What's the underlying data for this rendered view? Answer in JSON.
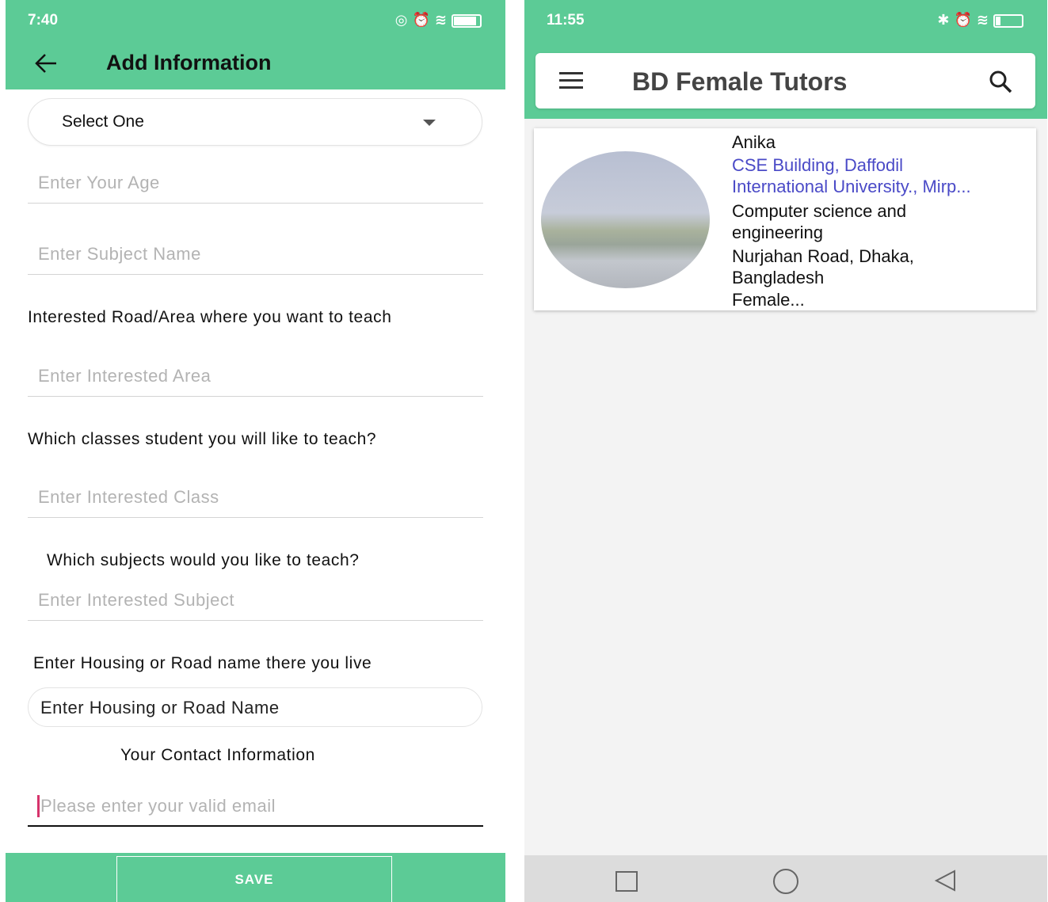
{
  "left_phone": {
    "status": {
      "time": "7:40"
    },
    "header": {
      "title": "Add Information"
    },
    "select": {
      "value": "Select One"
    },
    "fields": {
      "age_placeholder": "Enter Your Age",
      "subject_placeholder": "Enter Subject Name",
      "area_label": "Interested Road/Area where you want to teach",
      "area_placeholder": "Enter Interested Area",
      "class_label": "Which classes student you will like to teach?",
      "class_placeholder": "Enter Interested Class",
      "subjects_label": "Which subjects would you like to teach?",
      "subjects_placeholder": "Enter Interested Subject",
      "housing_label": "Enter Housing or Road name there you live",
      "housing_placeholder": "Enter Housing or Road Name",
      "contact_label": "Your Contact Information",
      "email_placeholder": "Please enter your valid email"
    },
    "save_label": "SAVE"
  },
  "right_phone": {
    "status": {
      "time": "11:55"
    },
    "toolbar": {
      "title": "BD Female Tutors"
    },
    "card": {
      "name": "Anika",
      "address_line1": "CSE Building, Daffodil",
      "address_line2": "International University., Mirp...",
      "dept_line1": "Computer science and",
      "dept_line2": "engineering",
      "location_line1": "Nurjahan Road, Dhaka,",
      "location_line2": "Bangladesh",
      "gender": "Female..."
    }
  },
  "colors": {
    "accent": "#5ccb96",
    "link": "#4a4ac7",
    "cursor": "#d6336c"
  }
}
